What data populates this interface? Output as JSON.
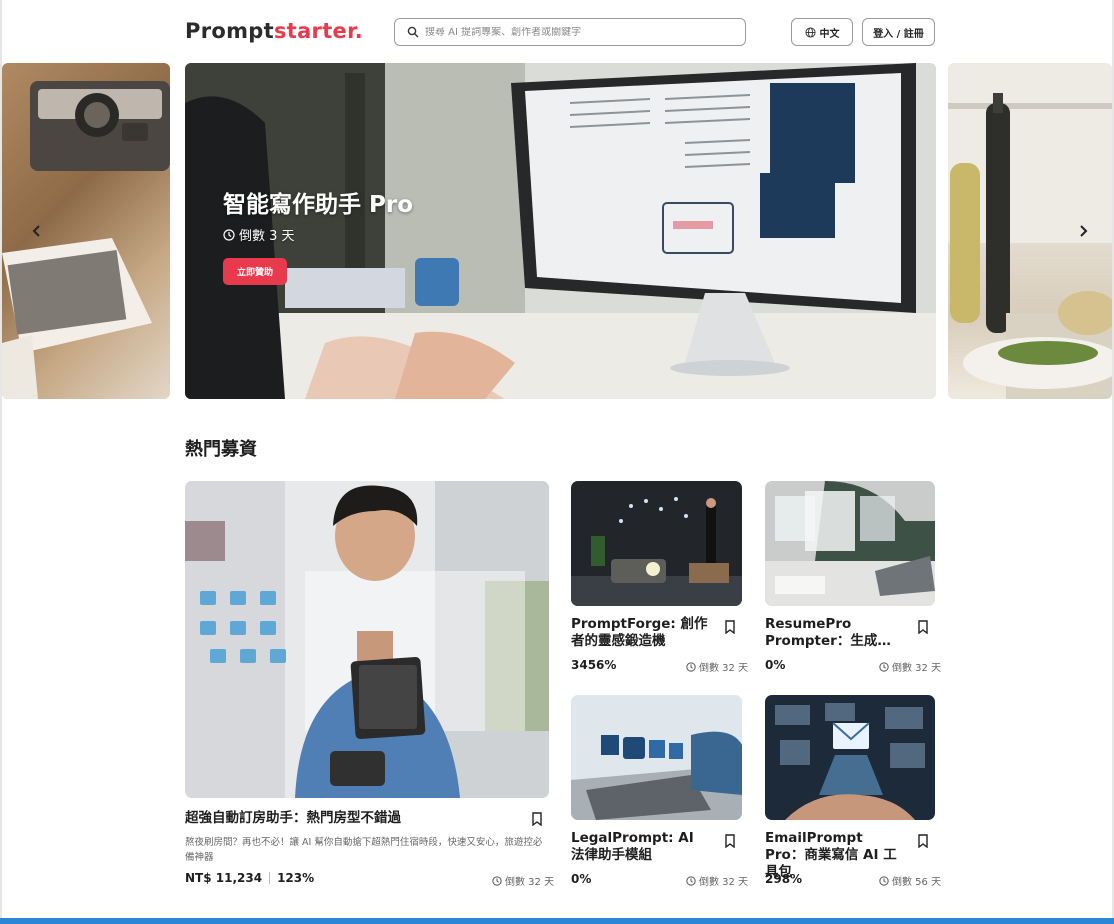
{
  "header": {
    "logo_part1": "Prompt",
    "logo_part2": "starter.",
    "search_placeholder": "搜尋 AI 提詞專案、創作者或關鍵字",
    "lang_label": "中文",
    "login_label": "登入 / 註冊"
  },
  "hero": {
    "title": "智能寫作助手 Pro",
    "countdown": "倒數 3 天",
    "cta_label": "立即贊助"
  },
  "section": {
    "title": "熱門募資"
  },
  "featured": {
    "title": "超強自動訂房助手：熱門房型不錯過",
    "description": "熬夜刷房間？再也不必！讓 AI 幫你自動搶下超熱門住宿時段，快速又安心，旅遊控必備神器",
    "price": "NT$ 11,234",
    "percent": "123%",
    "countdown": "倒數 32 天"
  },
  "cards": [
    {
      "title": "PromptForge: 創作者的靈感鍛造機",
      "percent": "3456%",
      "countdown": "倒數 32 天"
    },
    {
      "title": "ResumePro Prompter：生成…",
      "percent": "0%",
      "countdown": "倒數 32 天"
    },
    {
      "title": "LegalPrompt: AI 法律助手模組",
      "percent": "0%",
      "countdown": "倒數 32 天"
    },
    {
      "title": "EmailPrompt Pro：商業寫信 AI 工具包",
      "percent": "298%",
      "countdown": "倒數 56 天"
    }
  ],
  "colors": {
    "accent": "#e8394d",
    "bottom_bar": "#2b86d6"
  },
  "icons": [
    "search-icon",
    "globe-icon",
    "clock-icon",
    "bookmark-icon",
    "chevron-left-icon",
    "chevron-right-icon"
  ]
}
